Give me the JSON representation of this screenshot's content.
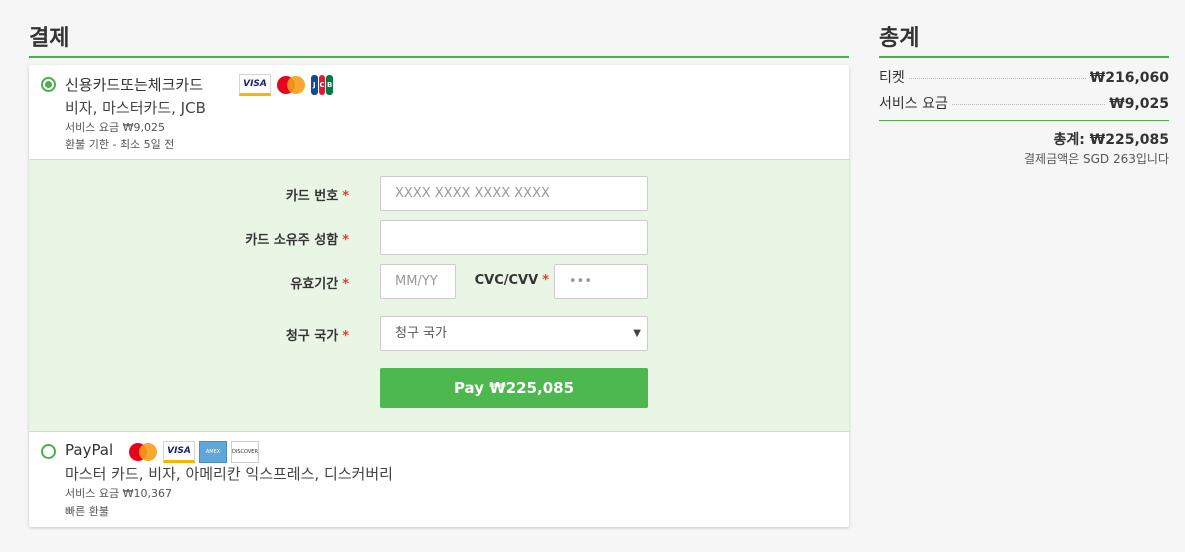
{
  "checkout": {
    "title": "결제",
    "card_option": {
      "title": "신용카드또는체크카드",
      "networks": "비자, 마스터카드, JCB",
      "fee": "서비스 요금 ₩9,025",
      "refund": "환불 기한 - 최소 5일 전",
      "logos": [
        "visa-logo",
        "mastercard-logo",
        "jcb-logo"
      ]
    },
    "form": {
      "card_number_label": "카드 번호",
      "card_number_placeholder": "XXXX XXXX XXXX XXXX",
      "holder_label": "카드 소유주 성함",
      "holder_placeholder": "",
      "expiry_label": "유효기간",
      "expiry_placeholder": "MM/YY",
      "cvc_label": "CVC/CVV",
      "cvc_placeholder": "•••",
      "country_label": "청구 국가",
      "country_value": "청구 국가",
      "required_mark": "*",
      "pay_button": "Pay ₩225,085"
    },
    "paypal_option": {
      "title": "PayPal",
      "networks": "마스터 카드, 비자, 아메리칸 익스프레스, 디스커버리",
      "fee": "서비스 요금 ₩10,367",
      "refund": "빠른 환불",
      "logos": [
        "mastercard-logo",
        "visa-logo",
        "amex-logo",
        "discover-logo"
      ]
    }
  },
  "summary": {
    "title": "총계",
    "rows": [
      {
        "label": "티켓",
        "value": "₩216,060"
      },
      {
        "label": "서비스 요금",
        "value": "₩9,025"
      }
    ],
    "total": "총계: ₩225,085",
    "note": "결제금액은 SGD 263입니다"
  },
  "colors": {
    "accent": "#4cae4c",
    "pay_button": "#4cb84e",
    "form_bg": "#e9f6e6",
    "required": "#e0403a"
  }
}
